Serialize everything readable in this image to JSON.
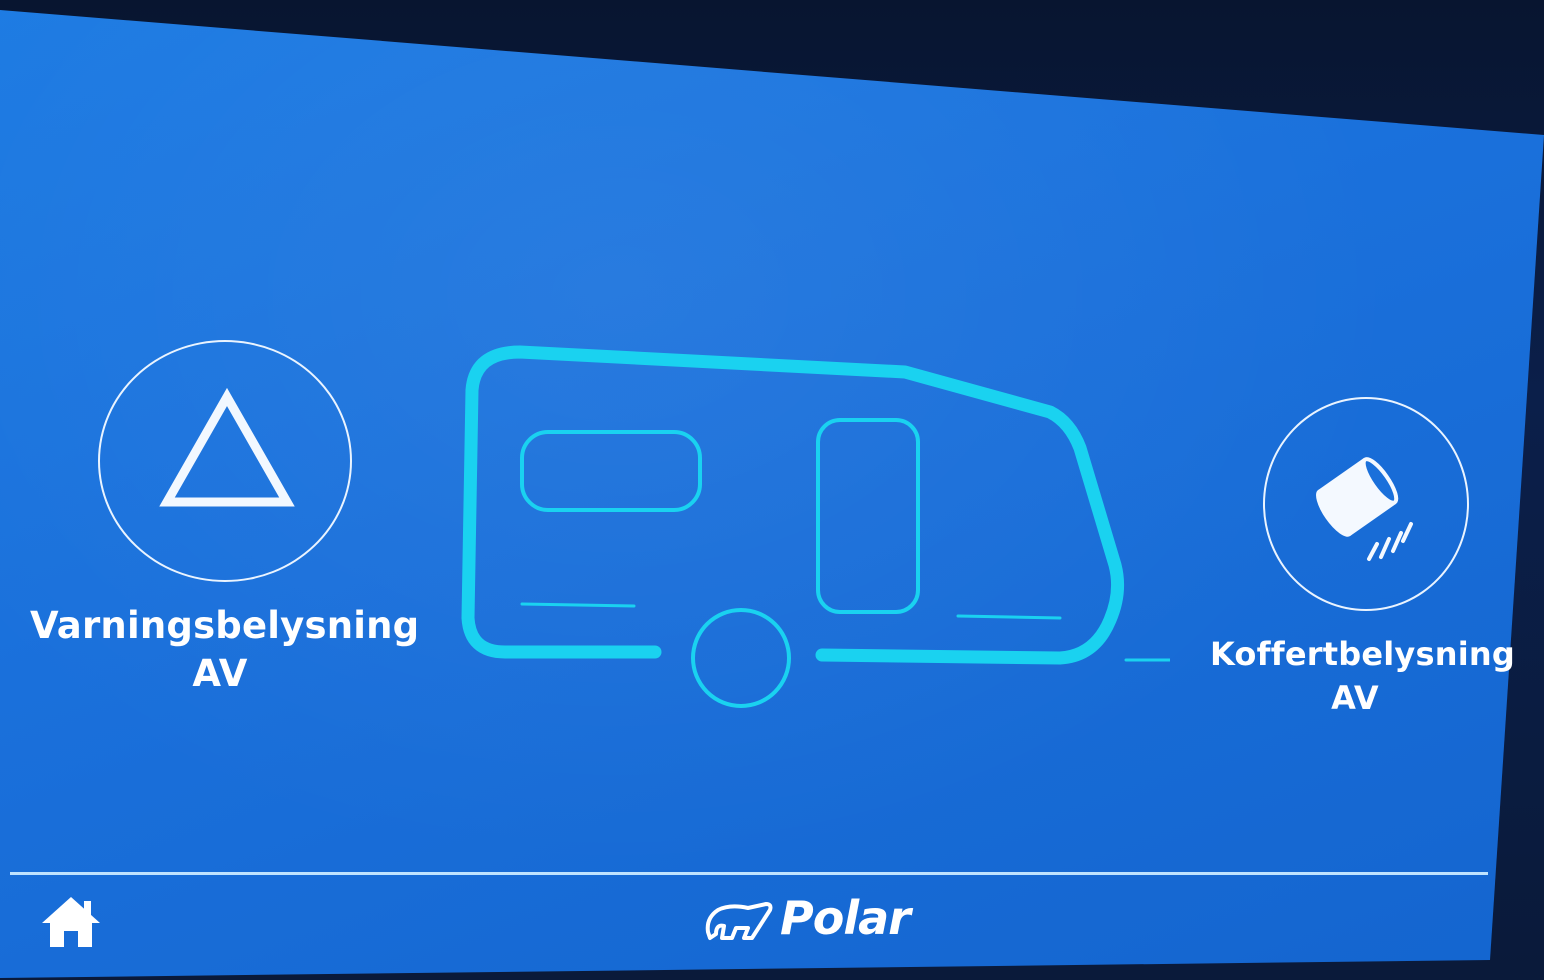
{
  "warning_light": {
    "title": "Varningsbelysning",
    "status": "AV",
    "icon": "warning-triangle-icon"
  },
  "trunk_light": {
    "title": "Koffertbelysning",
    "status": "AV",
    "icon": "lamp-icon"
  },
  "footer": {
    "home_icon": "home-icon",
    "brand": "Polar",
    "brand_logo": "polar-bear-logo"
  },
  "colors": {
    "screen_background": "#1a70db",
    "outline": "#1ad2f0",
    "text": "#ffffff"
  }
}
